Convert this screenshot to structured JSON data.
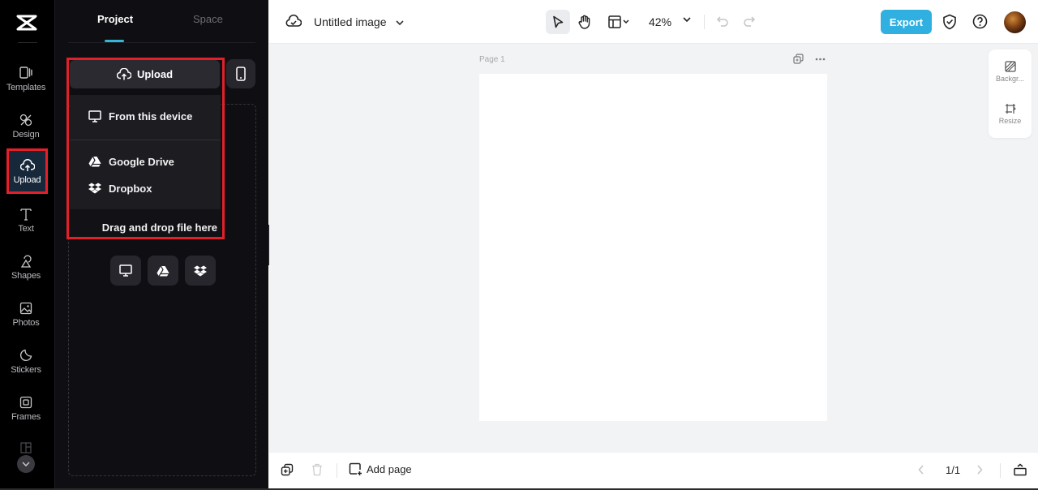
{
  "app": {
    "logo": "capcut-logo-icon"
  },
  "rail": {
    "items": [
      {
        "label": "Templates",
        "icon": "templates-icon"
      },
      {
        "label": "Design",
        "icon": "design-icon"
      },
      {
        "label": "Upload",
        "icon": "upload-cloud-icon",
        "active": true
      },
      {
        "label": "Text",
        "icon": "text-icon"
      },
      {
        "label": "Shapes",
        "icon": "shapes-icon"
      },
      {
        "label": "Photos",
        "icon": "photos-icon"
      },
      {
        "label": "Stickers",
        "icon": "stickers-icon"
      },
      {
        "label": "Frames",
        "icon": "frames-icon"
      }
    ],
    "more_icon": "chevron-down-icon"
  },
  "panel": {
    "tabs": [
      {
        "label": "Project",
        "active": true
      },
      {
        "label": "Space",
        "active": false
      }
    ],
    "upload_button": "Upload",
    "mobile_button_icon": "mobile-phone-icon",
    "menu": {
      "items": [
        {
          "label": "From this device",
          "icon": "monitor-icon"
        },
        {
          "label": "Google Drive",
          "icon": "google-drive-icon"
        },
        {
          "label": "Dropbox",
          "icon": "dropbox-icon"
        }
      ],
      "footer": "Drag and drop file here"
    },
    "sources": [
      "monitor-icon",
      "google-drive-icon",
      "dropbox-icon"
    ]
  },
  "topbar": {
    "title": "Untitled image",
    "zoom": "42%",
    "export_label": "Export",
    "accent": "#2fb0e0"
  },
  "canvas": {
    "page_label": "Page 1",
    "side_panel": [
      {
        "label": "Backgr...",
        "icon": "background-icon"
      },
      {
        "label": "Resize",
        "icon": "resize-icon"
      }
    ]
  },
  "bottombar": {
    "add_page": "Add page",
    "pager": "1/1"
  },
  "colors": {
    "highlight": "#e3202a",
    "tab_underline": "#35b6d6"
  }
}
